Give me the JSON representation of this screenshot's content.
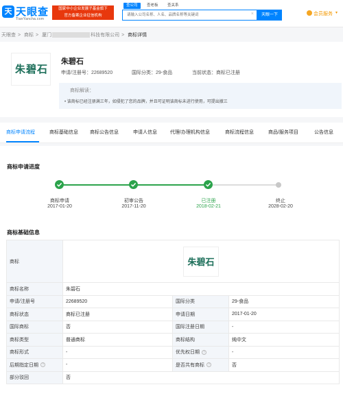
{
  "header": {
    "logo_mark": "天",
    "logo_text": "天眼查",
    "logo_domain": "TianYancha.com",
    "promo_line1": "国家中小企业发展子基金旗下",
    "promo_line2": "官方备案企业征信机构",
    "search_tabs": [
      "查公司",
      "查老板",
      "查关系"
    ],
    "search_placeholder": "请输入公司名称、人名、品牌名称等关键词",
    "search_button": "天眼一下",
    "vip_label": "会员服务"
  },
  "breadcrumb": {
    "items": [
      "天眼查",
      "商标",
      "厦门",
      "科技有限公司",
      "商标详情"
    ]
  },
  "trademark": {
    "logo_text": "朱碧石",
    "name": "朱碧石",
    "reg_no_label": "申请/注册号：",
    "reg_no": "22689520",
    "class_label": "国际分类：",
    "class_value": "29-食品",
    "status_label": "当前状态：",
    "status_value": "商标已注册",
    "interp_title": "商标解读：",
    "interp_text": "• 该商标已经注册满三年，如侵犯了您的品牌，并且可证明该商标未进行使用，可提出撤三"
  },
  "tabs": [
    "商标申请流程",
    "商标基础信息",
    "商标公告信息",
    "申请人信息",
    "代理/办理机构信息",
    "商标流程信息",
    "商品/服务项目",
    "公告信息"
  ],
  "progress": {
    "title": "商标申请进度",
    "steps": [
      {
        "label": "商标申请",
        "date": "2017-01-20"
      },
      {
        "label": "初审公告",
        "date": "2017-11-20"
      },
      {
        "label": "已注册",
        "date": "2018-02-21"
      },
      {
        "label": "终止",
        "date": "2028-02-20"
      }
    ]
  },
  "basic": {
    "title": "商标基础信息",
    "logo_label": "商标",
    "logo_text": "朱碧石",
    "name_label": "商标名称",
    "name_value": "朱碧石",
    "rows": [
      {
        "k1": "申请/注册号",
        "v1": "22689520",
        "k2": "国际分类",
        "v2": "29-食品"
      },
      {
        "k1": "商标状态",
        "v1": "商标已注册",
        "k2": "申请日期",
        "v2": "2017-01-20"
      },
      {
        "k1": "国际商标",
        "v1": "否",
        "k2": "国际注册日期",
        "v2": "-"
      },
      {
        "k1": "商标类型",
        "v1": "普通商标",
        "k2": "商标结构",
        "v2": "纯中文"
      },
      {
        "k1": "商标形式",
        "v1": "-",
        "k2": "优先权日期",
        "v2": "-"
      },
      {
        "k1": "后期指定日期",
        "v1": "-",
        "k2": "是否共有商标",
        "v2": "否"
      }
    ],
    "last_label": "部分驳回",
    "last_value": "否"
  },
  "colors": {
    "accent": "#0084ff",
    "success": "#2ba34b",
    "promo": "#e8380d",
    "vip": "#f39800"
  }
}
